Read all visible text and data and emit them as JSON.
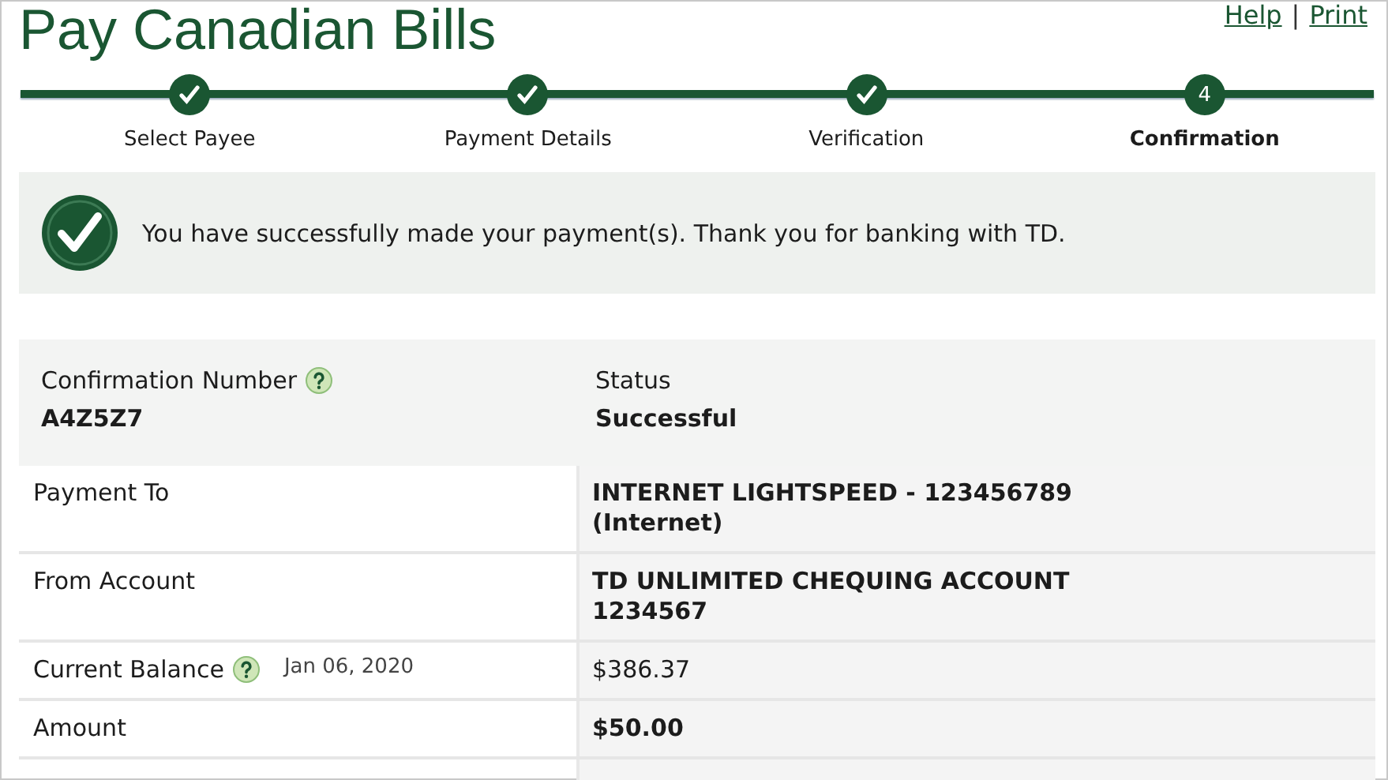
{
  "page": {
    "title": "Pay Canadian Bills",
    "links": [
      "Help",
      "Print"
    ],
    "separator": "|"
  },
  "steps": [
    {
      "label": "Select Payee",
      "done": true,
      "selected": false
    },
    {
      "label": "Payment Details",
      "done": true,
      "selected": false
    },
    {
      "label": "Verification",
      "done": true,
      "selected": false
    },
    {
      "label": "Confirmation",
      "done": false,
      "selected": true,
      "number": "4"
    }
  ],
  "message": {
    "text": "You have successfully made your payment(s). Thank you for banking with TD."
  },
  "summary": [
    {
      "label": "Confirmation Number",
      "help": true,
      "value": "A4Z5Z7"
    },
    {
      "label": "Status",
      "help": false,
      "value": "Successful"
    }
  ],
  "rows": [
    {
      "label": "Payment To",
      "help": false,
      "bold": true,
      "value": [
        "INTERNET LIGHTSPEED - 123456789",
        "(Internet)"
      ]
    },
    {
      "label": "From Account",
      "help": false,
      "bold": true,
      "value": [
        "TD UNLIMITED CHEQUING ACCOUNT",
        "1234567"
      ]
    },
    {
      "label": "Current Balance",
      "help": true,
      "date": "Jan 06, 2020",
      "bold": false,
      "value": [
        "$386.37"
      ]
    },
    {
      "label": "Amount",
      "help": false,
      "bold": true,
      "value": [
        "$50.00"
      ]
    }
  ]
}
